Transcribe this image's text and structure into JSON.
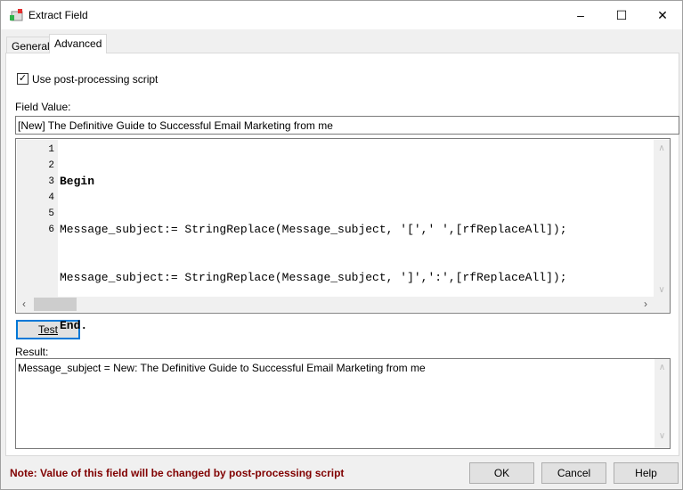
{
  "window": {
    "title": "Extract Field",
    "icon": "mail-extract-icon"
  },
  "tabs": [
    {
      "label": "General"
    },
    {
      "label": "Advanced",
      "active": true
    }
  ],
  "advanced": {
    "use_script_label": "Use post-processing script",
    "use_script_checked": true,
    "field_value_label": "Field Value:",
    "field_value": "[New] The Definitive Guide to Successful Email Marketing from me",
    "line_numbers": [
      "1",
      "2",
      "3",
      "4",
      "5",
      "6"
    ],
    "script_lines": [
      "Begin",
      "Message_subject:= StringReplace(Message_subject, '[',' ',[rfReplaceAll]);",
      "Message_subject:= StringReplace(Message_subject, ']',':',[rfReplaceAll]);",
      "End.",
      "",
      ""
    ],
    "test_button": "Test",
    "result_label": "Result:",
    "result_value": "Message_subject =  New: The Definitive Guide to Successful Email Marketing from me"
  },
  "footer": {
    "note": "Note: Value of this field will be changed by post-processing script",
    "note_color": "#800000",
    "ok": "OK",
    "cancel": "Cancel",
    "help": "Help"
  }
}
